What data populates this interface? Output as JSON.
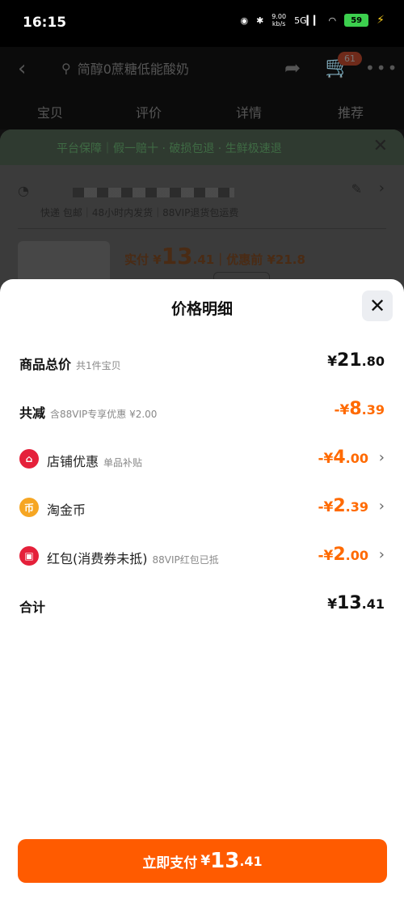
{
  "status": {
    "time": "16:15",
    "net_speed": "9.00\nkb/s",
    "signal": "5G",
    "battery": "59"
  },
  "topbar": {
    "search_text": "简醇0蔗糖低能酸奶",
    "cart_count": "61"
  },
  "tabs": [
    "宝贝",
    "评价",
    "详情",
    "推荐"
  ],
  "order_sheet": {
    "guarantee": "平台保障｜假一赔十 · 破损包退 · 生鲜极速退",
    "shipping": "快递 包邮｜48小时内发货｜88VIP退货包运费",
    "pay_label": "实付",
    "pay_int": "13",
    "pay_dec": ".41",
    "pre_discount": "｜优惠前 ¥21.8"
  },
  "detail": {
    "title": "价格明细",
    "rows": [
      {
        "label": "商品总价",
        "sub": "共1件宝贝",
        "yen": "¥",
        "int": "21",
        "dec": ".80"
      },
      {
        "label": "共减",
        "sub": "含88VIP专享优惠 ¥2.00",
        "yen": "-¥",
        "int": "8",
        "dec": ".39"
      },
      {
        "label": "店铺优惠",
        "sub": "单品补贴",
        "yen": "-¥",
        "int": "4",
        "dec": ".00"
      },
      {
        "label": "淘金币",
        "sub": "",
        "yen": "-¥",
        "int": "2",
        "dec": ".39"
      },
      {
        "label": "红包(消费券未抵)",
        "sub": "88VIP红包已抵",
        "yen": "-¥",
        "int": "2",
        "dec": ".00"
      },
      {
        "label": "合计",
        "sub": "",
        "yen": "¥",
        "int": "13",
        "dec": ".41"
      }
    ]
  },
  "pay_button": {
    "label": "立即支付",
    "yen": "¥",
    "int": "13",
    "dec": ".41"
  },
  "colors": {
    "accent": "#ff5b00",
    "discount": "#ff6a00"
  }
}
